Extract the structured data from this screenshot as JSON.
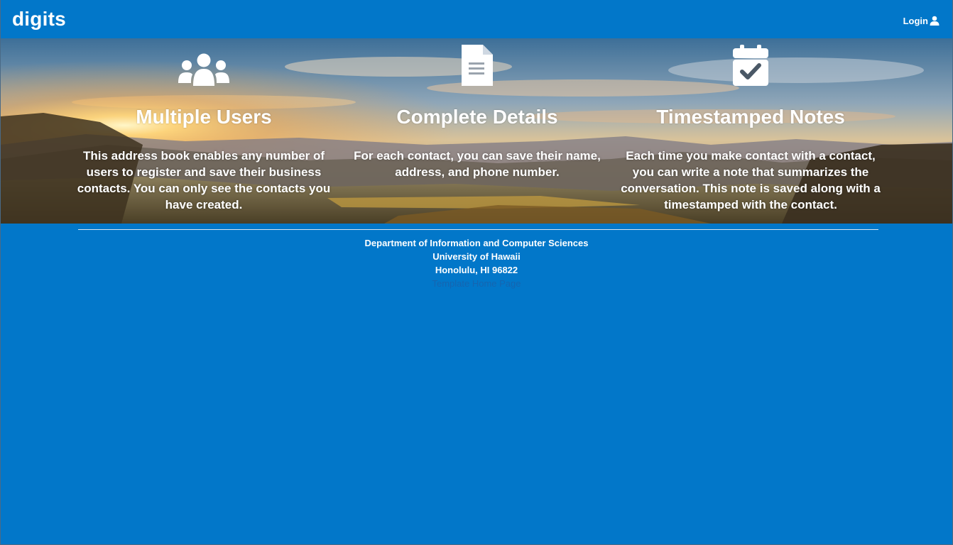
{
  "navbar": {
    "brand": "digits",
    "login_label": "Login",
    "login_icon": "user-icon"
  },
  "features": [
    {
      "icon": "users-icon",
      "title": "Multiple Users",
      "description": "This address book enables any number of users to register and save their business contacts. You can only see the contacts you have created."
    },
    {
      "icon": "file-text-icon",
      "title": "Complete Details",
      "description": "For each contact, you can save their name, address, and phone number."
    },
    {
      "icon": "calendar-check-icon",
      "title": "Timestamped Notes",
      "description": "Each time you make contact with a contact, you can write a note that summarizes the conversation. This note is saved along with a timestamped with the contact."
    }
  ],
  "footer": {
    "line1": "Department of Information and Computer Sciences",
    "line2": "University of Hawaii",
    "line3": "Honolulu, HI 96822",
    "link": "Template Home Page"
  },
  "colors": {
    "background": "#0277c9",
    "text": "#ffffff",
    "link": "#1565b0"
  }
}
